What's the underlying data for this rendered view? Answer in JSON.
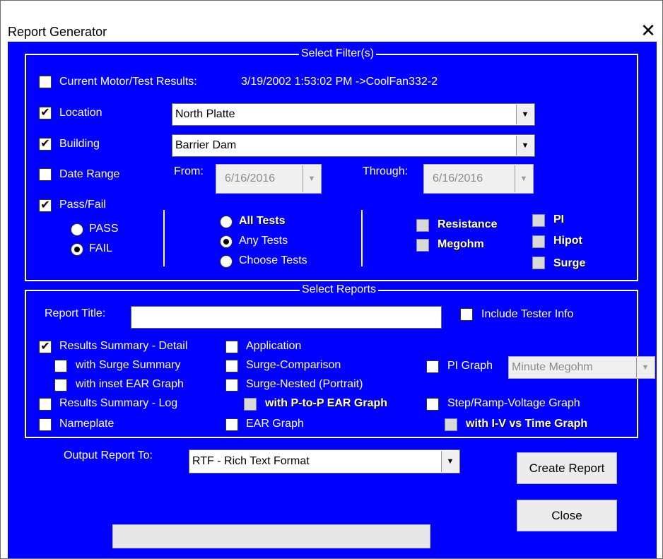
{
  "window": {
    "title": "Report Generator",
    "close_glyph": "✕"
  },
  "filters": {
    "group_title": "Select Filter(s)",
    "current_motor": {
      "label": "Current Motor/Test Results:",
      "value": "3/19/2002 1:53:02 PM ->CoolFan332-2",
      "checked": false
    },
    "location": {
      "label": "Location",
      "checked": true,
      "value": "North Platte"
    },
    "building": {
      "label": "Building",
      "checked": true,
      "value": "Barrier Dam"
    },
    "date_range": {
      "label": "Date Range",
      "checked": false,
      "from_label": "From:",
      "from_value": "6/16/2016",
      "through_label": "Through:",
      "through_value": "6/16/2016"
    },
    "pass_fail": {
      "label": "Pass/Fail",
      "checked": true,
      "pass_label": "PASS",
      "fail_label": "FAIL",
      "selected": "FAIL"
    },
    "tests": {
      "all_label": "All Tests",
      "any_label": "Any Tests",
      "choose_label": "Choose Tests",
      "selected": "Any Tests"
    },
    "test_types": {
      "resistance": "Resistance",
      "megohm": "Megohm",
      "pi": "PI",
      "hipot": "Hipot",
      "surge": "Surge"
    }
  },
  "reports": {
    "group_title": "Select Reports",
    "report_title_label": "Report Title:",
    "report_title_value": "",
    "include_tester_info": "Include Tester Info",
    "results_summary_detail": "Results Summary - Detail",
    "with_surge_summary": "with Surge Summary",
    "with_inset_ear_graph": "with inset EAR Graph",
    "results_summary_log": "Results Summary - Log",
    "nameplate": "Nameplate",
    "application": "Application",
    "surge_comparison": "Surge-Comparison",
    "surge_nested": "Surge-Nested (Portrait)",
    "with_ptop_ear_graph": "with P-to-P EAR Graph",
    "ear_graph": "EAR Graph",
    "pi_graph": "PI Graph",
    "pi_graph_select": "Minute Megohm",
    "step_ramp": "Step/Ramp-Voltage Graph",
    "with_iv_time": "with I-V vs Time Graph"
  },
  "output": {
    "label": "Output Report To:",
    "value": "RTF - Rich Text Format"
  },
  "buttons": {
    "create": "Create Report",
    "close": "Close"
  },
  "glyphs": {
    "check": "✔",
    "dropdown": "▼"
  },
  "colors": {
    "background": "#0000ff",
    "foreground": "#ffffff"
  }
}
